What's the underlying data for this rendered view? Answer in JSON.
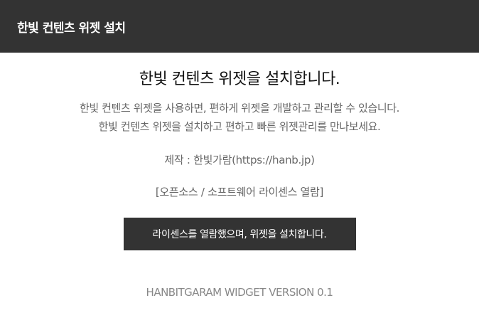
{
  "header": {
    "title": "한빛 컨텐츠 위젯 설치"
  },
  "main": {
    "title": "한빛 컨텐츠 위젯을 설치합니다.",
    "description_lines": [
      "한빛 컨텐츠 위젯을 사용하면, 편하게 위젯을 개발하고 관리할 수 있습니다.",
      "한빛 컨텐츠 위젯을 설치하고 편하고 빠른 위젯관리를 만나보세요."
    ],
    "maker": "제작 : 한빛가람(https://hanb.jp)",
    "license_link": "[오픈소스 / 소프트웨어 라이센스 열람]",
    "install_button": "라이센스를 열람했으며, 위젯을 설치합니다.",
    "version": "HANBITGARAM WIDGET VERSION 0.1"
  },
  "colors": {
    "header_bg": "#333333",
    "button_bg": "#333333",
    "text_muted": "#666666"
  }
}
